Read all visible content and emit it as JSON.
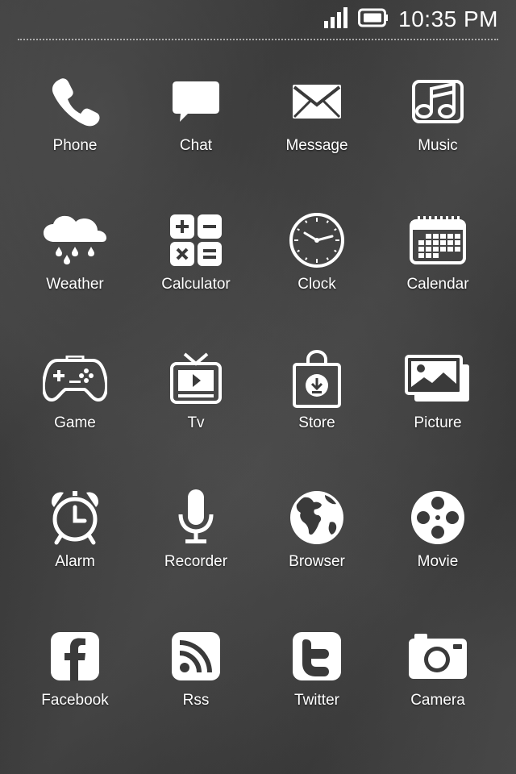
{
  "status_bar": {
    "time": "10:35 PM",
    "signal_icon": "signal-bars-icon",
    "battery_icon": "battery-icon"
  },
  "theme": {
    "icon_color": "#ffffff",
    "background": "#3a3a3a"
  },
  "apps": [
    {
      "label": "Phone",
      "icon": "phone-icon"
    },
    {
      "label": "Chat",
      "icon": "chat-bubble-icon"
    },
    {
      "label": "Message",
      "icon": "envelope-icon"
    },
    {
      "label": "Music",
      "icon": "music-note-icon"
    },
    {
      "label": "Weather",
      "icon": "rain-cloud-icon"
    },
    {
      "label": "Calculator",
      "icon": "calculator-icon"
    },
    {
      "label": "Clock",
      "icon": "clock-icon"
    },
    {
      "label": "Calendar",
      "icon": "calendar-icon"
    },
    {
      "label": "Game",
      "icon": "gamepad-icon"
    },
    {
      "label": "Tv",
      "icon": "tv-icon"
    },
    {
      "label": "Store",
      "icon": "shopping-bag-icon"
    },
    {
      "label": "Picture",
      "icon": "picture-icon"
    },
    {
      "label": "Alarm",
      "icon": "alarm-clock-icon"
    },
    {
      "label": "Recorder",
      "icon": "microphone-icon"
    },
    {
      "label": "Browser",
      "icon": "globe-icon"
    },
    {
      "label": "Movie",
      "icon": "film-reel-icon"
    },
    {
      "label": "Facebook",
      "icon": "facebook-icon"
    },
    {
      "label": "Rss",
      "icon": "rss-icon"
    },
    {
      "label": "Twitter",
      "icon": "twitter-icon"
    },
    {
      "label": "Camera",
      "icon": "camera-icon"
    }
  ]
}
